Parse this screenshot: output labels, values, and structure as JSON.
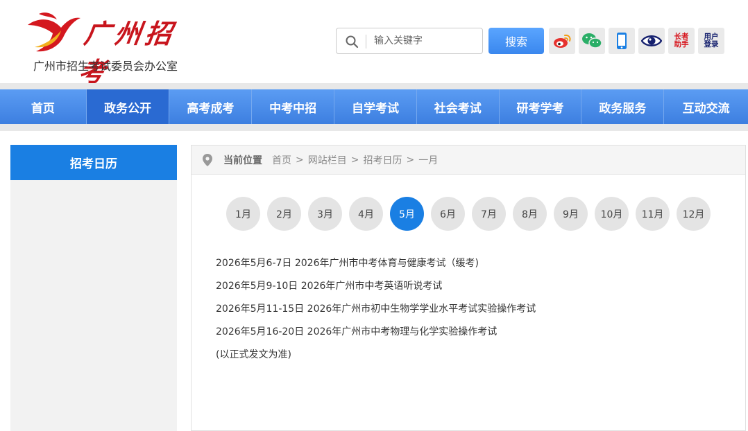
{
  "header": {
    "logo_title": "广州招考",
    "logo_subtitle": "广州市招生考试委员会办公室",
    "search": {
      "placeholder": "输入关键字",
      "button_label": "搜索"
    },
    "icons": [
      {
        "name": "weibo-icon"
      },
      {
        "name": "wechat-icon"
      },
      {
        "name": "mobile-icon"
      },
      {
        "name": "eye-icon"
      },
      {
        "name": "elder-assist-icon",
        "label_line1": "长者",
        "label_line2": "助手"
      },
      {
        "name": "user-login-icon",
        "label_line1": "用户",
        "label_line2": "登录"
      }
    ]
  },
  "nav": {
    "items": [
      "首页",
      "政务公开",
      "高考成考",
      "中考中招",
      "自学考试",
      "社会考试",
      "研考学考",
      "政务服务",
      "互动交流"
    ],
    "active_index": 1
  },
  "sidebar": {
    "title": "招考日历"
  },
  "breadcrumb": {
    "label": "当前位置",
    "items": [
      "首页",
      "网站栏目",
      "招考日历",
      "一月"
    ]
  },
  "months": {
    "items": [
      "1月",
      "2月",
      "3月",
      "4月",
      "5月",
      "6月",
      "7月",
      "8月",
      "9月",
      "10月",
      "11月",
      "12月"
    ],
    "active_index": 4
  },
  "events": [
    "2026年5月6-7日 2026年广州市中考体育与健康考试（缓考)",
    "2026年5月9-10日 2026年广州市中考英语听说考试",
    "2026年5月11-15日 2026年广州市初中生物学学业水平考试实验操作考试",
    "2026年5月16-20日 2026年广州市中考物理与化学实验操作考试",
    "(以正式发文为准)"
  ],
  "colors": {
    "brand_red": "#c8151d",
    "primary_blue": "#1a7fe3",
    "nav_blue": "#3d7fe0"
  }
}
